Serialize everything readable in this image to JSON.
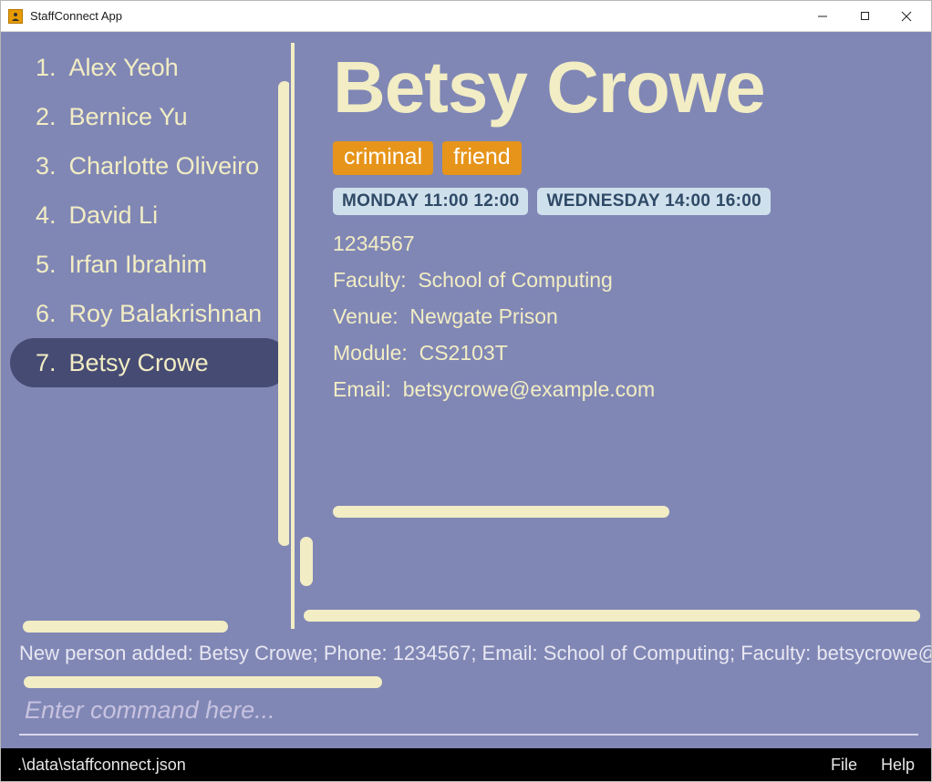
{
  "window": {
    "title": "StaffConnect App"
  },
  "sidebar": {
    "items": [
      {
        "index": "1.",
        "name": "Alex Yeoh"
      },
      {
        "index": "2.",
        "name": "Bernice Yu"
      },
      {
        "index": "3.",
        "name": "Charlotte Oliveiro"
      },
      {
        "index": "4.",
        "name": "David Li"
      },
      {
        "index": "5.",
        "name": "Irfan Ibrahim"
      },
      {
        "index": "6.",
        "name": "Roy Balakrishnan"
      },
      {
        "index": "7.",
        "name": "Betsy Crowe"
      }
    ],
    "selected_index": 6
  },
  "detail": {
    "name": "Betsy Crowe",
    "tags": [
      "criminal",
      "friend"
    ],
    "slots": [
      "MONDAY 11:00 12:00",
      "WEDNESDAY 14:00 16:00"
    ],
    "phone": "1234567",
    "faculty_label": "Faculty:",
    "faculty_value": "School of Computing",
    "venue_label": "Venue:",
    "venue_value": "Newgate Prison",
    "module_label": "Module:",
    "module_value": "CS2103T",
    "email_label": "Email:",
    "email_value": "betsycrowe@example.com"
  },
  "status": {
    "message": "New person added: Betsy Crowe; Phone: 1234567; Email: School of Computing; Faculty: betsycrowe@examp"
  },
  "command": {
    "placeholder": "Enter command here..."
  },
  "bottombar": {
    "path": ".\\data\\staffconnect.json",
    "menu_file": "File",
    "menu_help": "Help"
  }
}
